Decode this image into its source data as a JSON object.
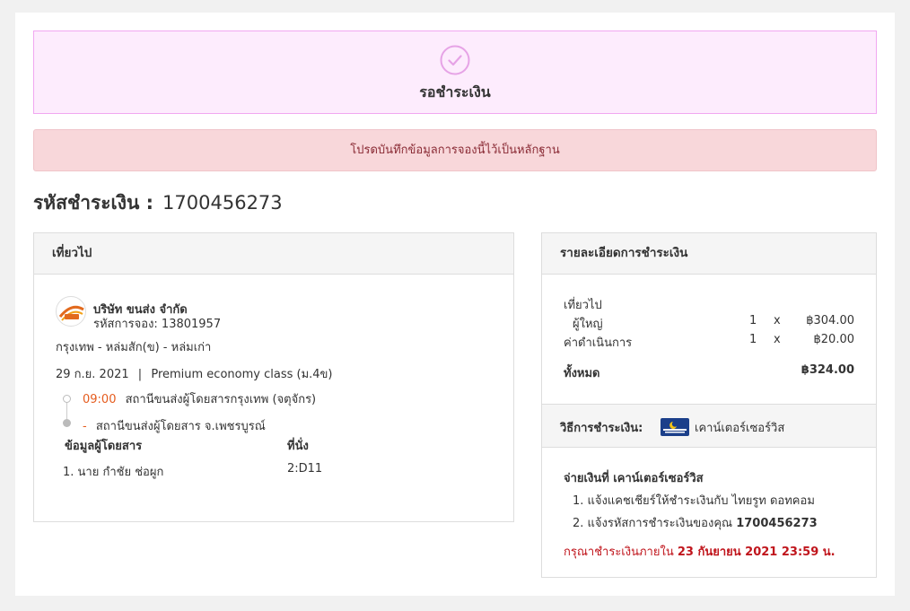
{
  "status": {
    "text": "รอชำระเงิน",
    "icon": "check-circle-icon",
    "color": "#f1a7f1"
  },
  "alert": {
    "text": "โปรดบันทึกข้อมูลการจองนี้ไว้เป็นหลักฐาน"
  },
  "payment_code": {
    "label": "รหัสชำระเงิน :",
    "value": "1700456273"
  },
  "trip": {
    "header": "เที่ยวไป",
    "company": "บริษัท ขนส่ง จำกัด",
    "booking_code": "รหัสการจอง: 13801957",
    "route": "กรุงเทพ - หล่มสัก(ข) - หล่มเก่า",
    "date": "29 ก.ย. 2021",
    "separator": "|",
    "class": "Premium economy class (ม.4ข)",
    "depart_time": "09:00",
    "depart_station": "สถานีขนส่งผู้โดยสารกรุงเทพ (จตุจักร)",
    "arrive_time": "-",
    "arrive_station": "สถานีขนส่งผู้โดยสาร จ.เพชรบูรณ์",
    "passenger_header": "ข้อมูลผู้โดยสาร",
    "seat_header": "ที่นั่ง",
    "passengers": [
      {
        "name": "1. นาย กำชัย ช่อผูก",
        "seat": "2:D11"
      }
    ]
  },
  "summary": {
    "header": "รายละเอียดการชำระเงิน",
    "section": "เที่ยวไป",
    "items": [
      {
        "label": "ผู้ใหญ่",
        "qty": "1",
        "x": "x",
        "price": "฿304.00"
      },
      {
        "label": "ค่าดำเนินการ",
        "qty": "1",
        "x": "x",
        "price": "฿20.00"
      }
    ],
    "total_label": "ทั้งหมด",
    "total_value": "฿324.00",
    "method_label": "วิธีการชำระเงิน:",
    "method_name": "เคาน์เตอร์เซอร์วิส",
    "pay_title": "จ่ายเงินที่ เคาน์เตอร์เซอร์วิส",
    "steps": [
      "1. แจ้งแคชเชียร์ให้ชำระเงินกับ ไทยรูท ดอทคอม",
      "2. แจ้งรหัสการชำระเงินของคุณ "
    ],
    "step2_code": "1700456273",
    "deadline_prefix": "กรุณาชำระเงินภายใน ",
    "deadline_value": "23 กันยายน 2021 23:59 น.",
    "deadline_color": "#c0151c"
  }
}
